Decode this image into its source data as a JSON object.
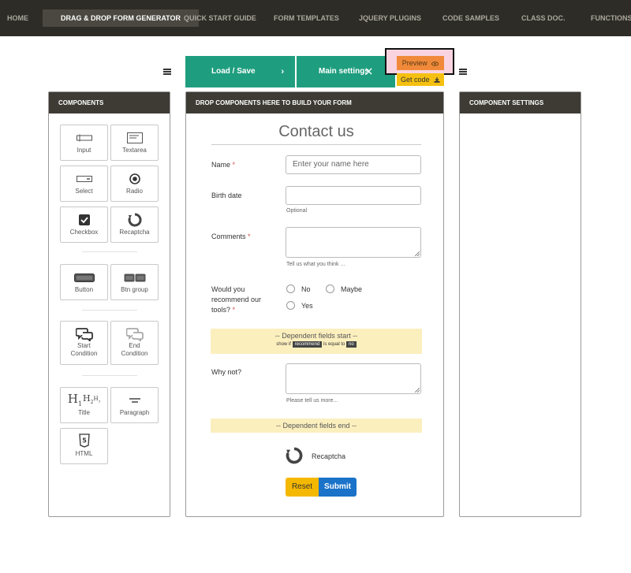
{
  "nav": {
    "items": [
      {
        "label": "HOME"
      },
      {
        "label": "DRAG & DROP FORM GENERATOR"
      },
      {
        "label": "QUICK START GUIDE"
      },
      {
        "label": "FORM TEMPLATES"
      },
      {
        "label": "JQUERY PLUGINS"
      },
      {
        "label": "CODE SAMPLES"
      },
      {
        "label": "CLASS DOC."
      },
      {
        "label": "FUNCTIONS RE"
      }
    ]
  },
  "toolbar": {
    "load_save": "Load / Save",
    "main_settings": "Main settings",
    "preview": "Preview",
    "get_code": "Get code"
  },
  "components_panel": {
    "title": "COMPONENTS",
    "items": [
      {
        "label": "Input",
        "icon": "input-icon"
      },
      {
        "label": "Textarea",
        "icon": "textarea-icon"
      },
      {
        "label": "Select",
        "icon": "select-icon"
      },
      {
        "label": "Radio",
        "icon": "radio-icon"
      },
      {
        "label": "Checkbox",
        "icon": "checkbox-icon"
      },
      {
        "label": "Recaptcha",
        "icon": "recaptcha-icon"
      },
      {
        "label": "Button",
        "icon": "button-icon"
      },
      {
        "label": "Btn group",
        "icon": "btn-group-icon"
      },
      {
        "label_line1": "Start",
        "label_line2": "Condition",
        "icon": "start-condition-icon"
      },
      {
        "label_line1": "End",
        "label_line2": "Condition",
        "icon": "end-condition-icon"
      },
      {
        "label": "Title",
        "icon": "title-icon"
      },
      {
        "label": "Paragraph",
        "icon": "paragraph-icon"
      },
      {
        "label": "HTML",
        "icon": "html5-icon"
      }
    ]
  },
  "drop_panel": {
    "title": "DROP COMPONENTS HERE TO BUILD YOUR FORM"
  },
  "settings_panel": {
    "title": "COMPONENT SETTINGS"
  },
  "form": {
    "title": "Contact us",
    "name": {
      "label": "Name",
      "placeholder": "Enter your name here"
    },
    "birth_date": {
      "label": "Birth date",
      "help": "Optional"
    },
    "comments": {
      "label": "Comments",
      "help": "Tell us what you think ..."
    },
    "recommend": {
      "label_line1": "Would you",
      "label_line2": "recommend our",
      "label_line3": "tools?",
      "options": [
        "No",
        "Maybe",
        "Yes"
      ]
    },
    "dependent_start": {
      "title": "-- Dependent fields start --",
      "prefix": "show if",
      "field": "recommend",
      "operator": "is equal to",
      "value": "no"
    },
    "why_not": {
      "label": "Why not?",
      "help": "Please tell us more..."
    },
    "dependent_end": {
      "title": "-- Dependent fields end --"
    },
    "recaptcha": {
      "label": "Recaptcha"
    },
    "reset": "Reset",
    "submit": "Submit",
    "required_mark": "*"
  },
  "colors": {
    "nav_bg": "#2e2c26",
    "accent_green": "#1f9e7f",
    "preview_orange": "#f08a3a",
    "get_code_yellow": "#f5c011",
    "submit_blue": "#1a73c9",
    "reset_yellow": "#f5b800",
    "dependent_bg": "#fcefbe"
  }
}
